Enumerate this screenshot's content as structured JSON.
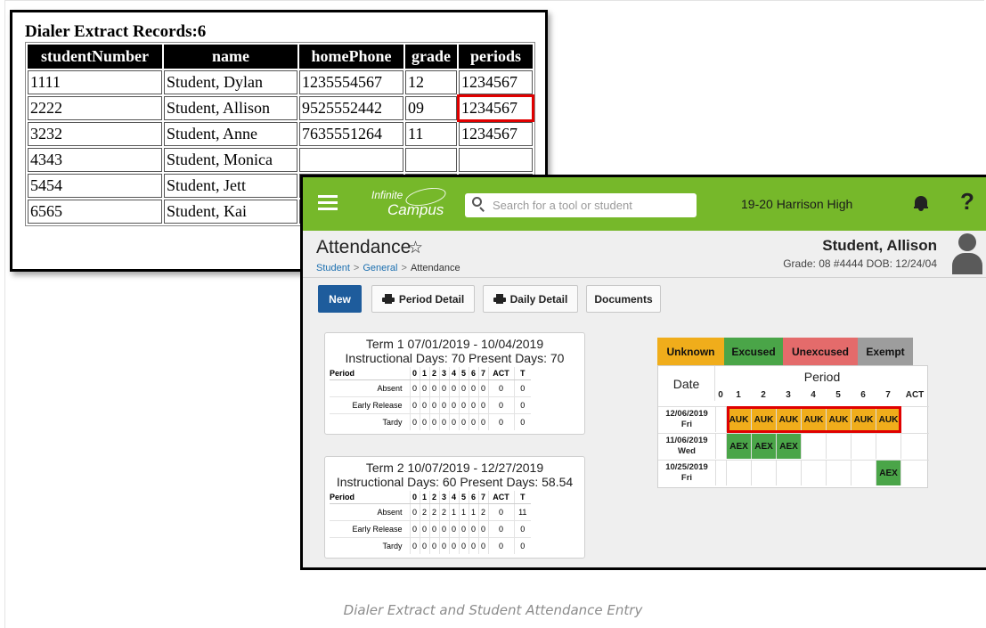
{
  "dialer": {
    "title": "Dialer Extract Records:6",
    "columns": [
      "studentNumber",
      "name",
      "homePhone",
      "grade",
      "periods"
    ],
    "rows": [
      [
        "1111",
        "Student, Dylan",
        "1235554567",
        "12",
        "1234567"
      ],
      [
        "2222",
        "Student, Allison",
        "9525552442",
        "09",
        "1234567"
      ],
      [
        "3232",
        "Student, Anne",
        "7635551264",
        "11",
        "1234567"
      ],
      [
        "4343",
        "Student, Monica",
        "",
        "",
        ""
      ],
      [
        "5454",
        "Student, Jett",
        "",
        "",
        ""
      ],
      [
        "6565",
        "Student, Kai",
        "",
        "",
        ""
      ]
    ]
  },
  "ic": {
    "logo_top": "Infinite",
    "logo_bottom": "Campus",
    "search_placeholder": "Search for a tool or student",
    "school": "19-20 Harrison High",
    "help": "?",
    "page_title": "Attendance",
    "star": "☆",
    "breadcrumb": [
      "Student",
      "General",
      "Attendance"
    ],
    "breadcrumb_sep": ">",
    "student_name": "Student, Allison",
    "student_info": "Grade: 08 #4444 DOB: 12/24/04",
    "buttons": {
      "new": "New",
      "period_detail": "Period Detail",
      "daily_detail": "Daily Detail",
      "documents": "Documents"
    },
    "terms": [
      {
        "title": "Term 1 07/01/2019 - 10/04/2019",
        "subtitle": "Instructional Days: 70   Present Days: 70",
        "header": [
          "Period",
          "0",
          "1",
          "2",
          "3",
          "4",
          "5",
          "6",
          "7",
          "ACT",
          "T"
        ],
        "rows": [
          [
            "Absent",
            "0",
            "0",
            "0",
            "0",
            "0",
            "0",
            "0",
            "0",
            "0",
            "0"
          ],
          [
            "Early Release",
            "0",
            "0",
            "0",
            "0",
            "0",
            "0",
            "0",
            "0",
            "0",
            "0"
          ],
          [
            "Tardy",
            "0",
            "0",
            "0",
            "0",
            "0",
            "0",
            "0",
            "0",
            "0",
            "0"
          ]
        ]
      },
      {
        "title": "Term 2 10/07/2019 - 12/27/2019",
        "subtitle": "Instructional Days: 60   Present Days: 58.54",
        "header": [
          "Period",
          "0",
          "1",
          "2",
          "3",
          "4",
          "5",
          "6",
          "7",
          "ACT",
          "T"
        ],
        "rows": [
          [
            "Absent",
            "0",
            "2",
            "2",
            "2",
            "1",
            "1",
            "1",
            "2",
            "0",
            "11"
          ],
          [
            "Early Release",
            "0",
            "0",
            "0",
            "0",
            "0",
            "0",
            "0",
            "0",
            "0",
            "0"
          ],
          [
            "Tardy",
            "0",
            "0",
            "0",
            "0",
            "0",
            "0",
            "0",
            "0",
            "0",
            "0"
          ]
        ]
      }
    ],
    "legend": [
      {
        "label": "Unknown",
        "color": "#f0ad1b"
      },
      {
        "label": "Excused",
        "color": "#4aa548"
      },
      {
        "label": "Unexcused",
        "color": "#e46b6b"
      },
      {
        "label": "Exempt",
        "color": "#9d9d9d"
      }
    ],
    "grid": {
      "date_header": "Date",
      "period_header": "Period",
      "columns": [
        "0",
        "1",
        "2",
        "3",
        "4",
        "5",
        "6",
        "7",
        "ACT"
      ],
      "rows": [
        {
          "date": "12/06/2019",
          "day": "Fri",
          "cells": [
            "",
            "AUK",
            "AUK",
            "AUK",
            "AUK",
            "AUK",
            "AUK",
            "AUK",
            ""
          ]
        },
        {
          "date": "11/06/2019",
          "day": "Wed",
          "cells": [
            "",
            "AEX",
            "AEX",
            "AEX",
            "",
            "",
            "",
            "",
            ""
          ]
        },
        {
          "date": "10/25/2019",
          "day": "Fri",
          "cells": [
            "",
            "",
            "",
            "",
            "",
            "",
            "",
            "AEX",
            ""
          ]
        }
      ]
    }
  },
  "caption": "Dialer Extract and Student Attendance Entry"
}
